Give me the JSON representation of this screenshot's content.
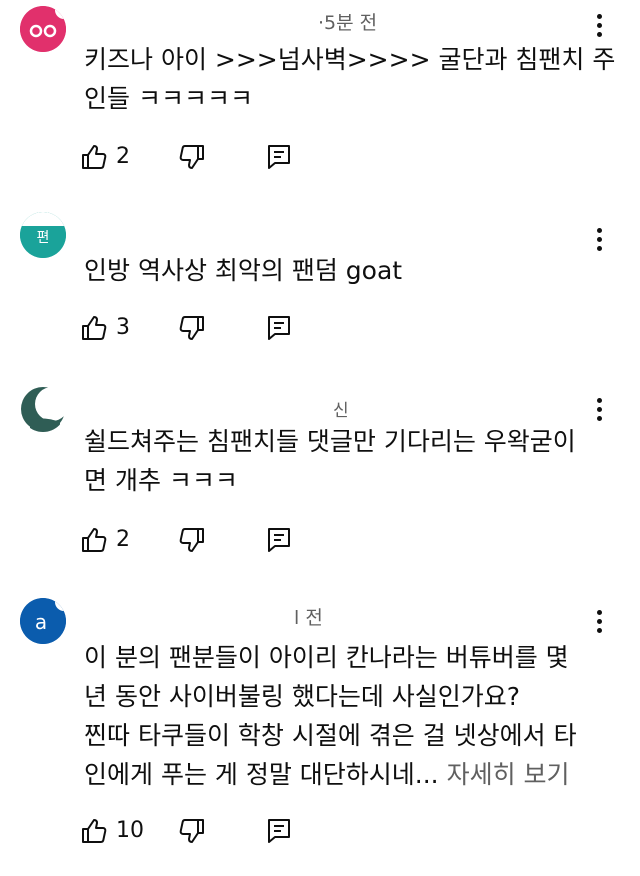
{
  "comments": [
    {
      "avatar_color": "#e1306c",
      "meta": "·5분 전",
      "lines": [
        "키즈나 아이 >>>넘사벽>>>> 굴단과 침팬치 주",
        "인들 ㅋㅋㅋㅋㅋ"
      ],
      "likes": "2",
      "more": ""
    },
    {
      "avatar_color": "#1aa39a",
      "meta": "",
      "lines": [
        "인방 역사상 최악의 팬덤 goat"
      ],
      "likes": "3",
      "more": ""
    },
    {
      "avatar_color": "#2f5d55",
      "meta": "신",
      "lines": [
        "쉴드쳐주는 침팬치들 댓글만 기다리는 우왁굳이",
        "면 개추 ㅋㅋㅋ"
      ],
      "likes": "2",
      "more": ""
    },
    {
      "avatar_color": "#0b5cad",
      "avatar_letter": "a",
      "meta": "l 전",
      "lines": [
        "이 분의 팬분들이 아이리 칸나라는 버튜버를 몇",
        "년 동안 사이버불링 했다는데 사실인가요?",
        "찐따 타쿠들이 학창 시절에 겪은 걸 넷상에서 타",
        "인에게 푸는 게 정말 대단하시네..."
      ],
      "likes": "10",
      "more": "자세히 보기"
    }
  ],
  "icons": {
    "like": "thumbs-up-icon",
    "dislike": "thumbs-down-icon",
    "reply": "reply-icon",
    "menu": "more-vert-icon"
  }
}
